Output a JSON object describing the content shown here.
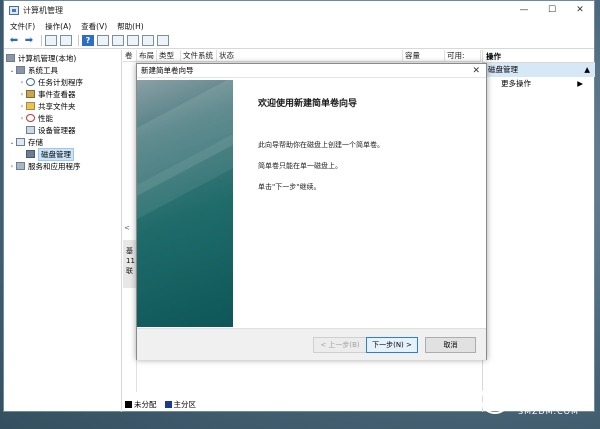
{
  "window": {
    "title": "计算机管理",
    "controls": {
      "minimize": "—",
      "maximize": "☐",
      "close": "✕"
    }
  },
  "menu": [
    "文件(F)",
    "操作(A)",
    "查看(V)",
    "帮助(H)"
  ],
  "toolbar": {
    "help_glyph": "?"
  },
  "tree": {
    "root": "计算机管理(本地)",
    "system_tools": "系统工具",
    "task_scheduler": "任务计划程序",
    "event_viewer": "事件查看器",
    "shared_folders": "共享文件夹",
    "performance": "性能",
    "device_manager": "设备管理器",
    "storage": "存储",
    "disk_management": "磁盘管理",
    "services_apps": "服务和应用程序",
    "chevron_collapsed": "›",
    "chevron_expanded": "⌄"
  },
  "columns": [
    "卷",
    "布局",
    "类型",
    "文件系统",
    "状态",
    "容量",
    "可用:"
  ],
  "disk_panel": {
    "scroll_left": "<",
    "line1": "基",
    "line2": "11",
    "line3": "联"
  },
  "legend": [
    {
      "label": "未分配",
      "color": "#000000"
    },
    {
      "label": "主分区",
      "color": "#1b3a8c"
    }
  ],
  "actions": {
    "header": "操作",
    "section": "磁盘管理",
    "more": "更多操作",
    "collapse_glyph": "▲",
    "more_glyph": "▶"
  },
  "dialog": {
    "title": "新建简单卷向导",
    "close": "✕",
    "heading": "欢迎使用新建简单卷向导",
    "para1": "此向导帮助你在磁盘上创建一个简单卷。",
    "para2": "简单卷只能在单一磁盘上。",
    "para3": "单击\"下一步\"继续。",
    "back_button": "< 上一步(B)",
    "next_button": "下一步(N) >",
    "cancel_button": "取消"
  },
  "watermark": {
    "logo_glyph": "值",
    "text": "什么值得买",
    "sub": "SMZDM.COM"
  },
  "colors": {
    "accent": "#2d7fd6",
    "selection": "#cce4f7",
    "banner": "#1f6b6a"
  }
}
